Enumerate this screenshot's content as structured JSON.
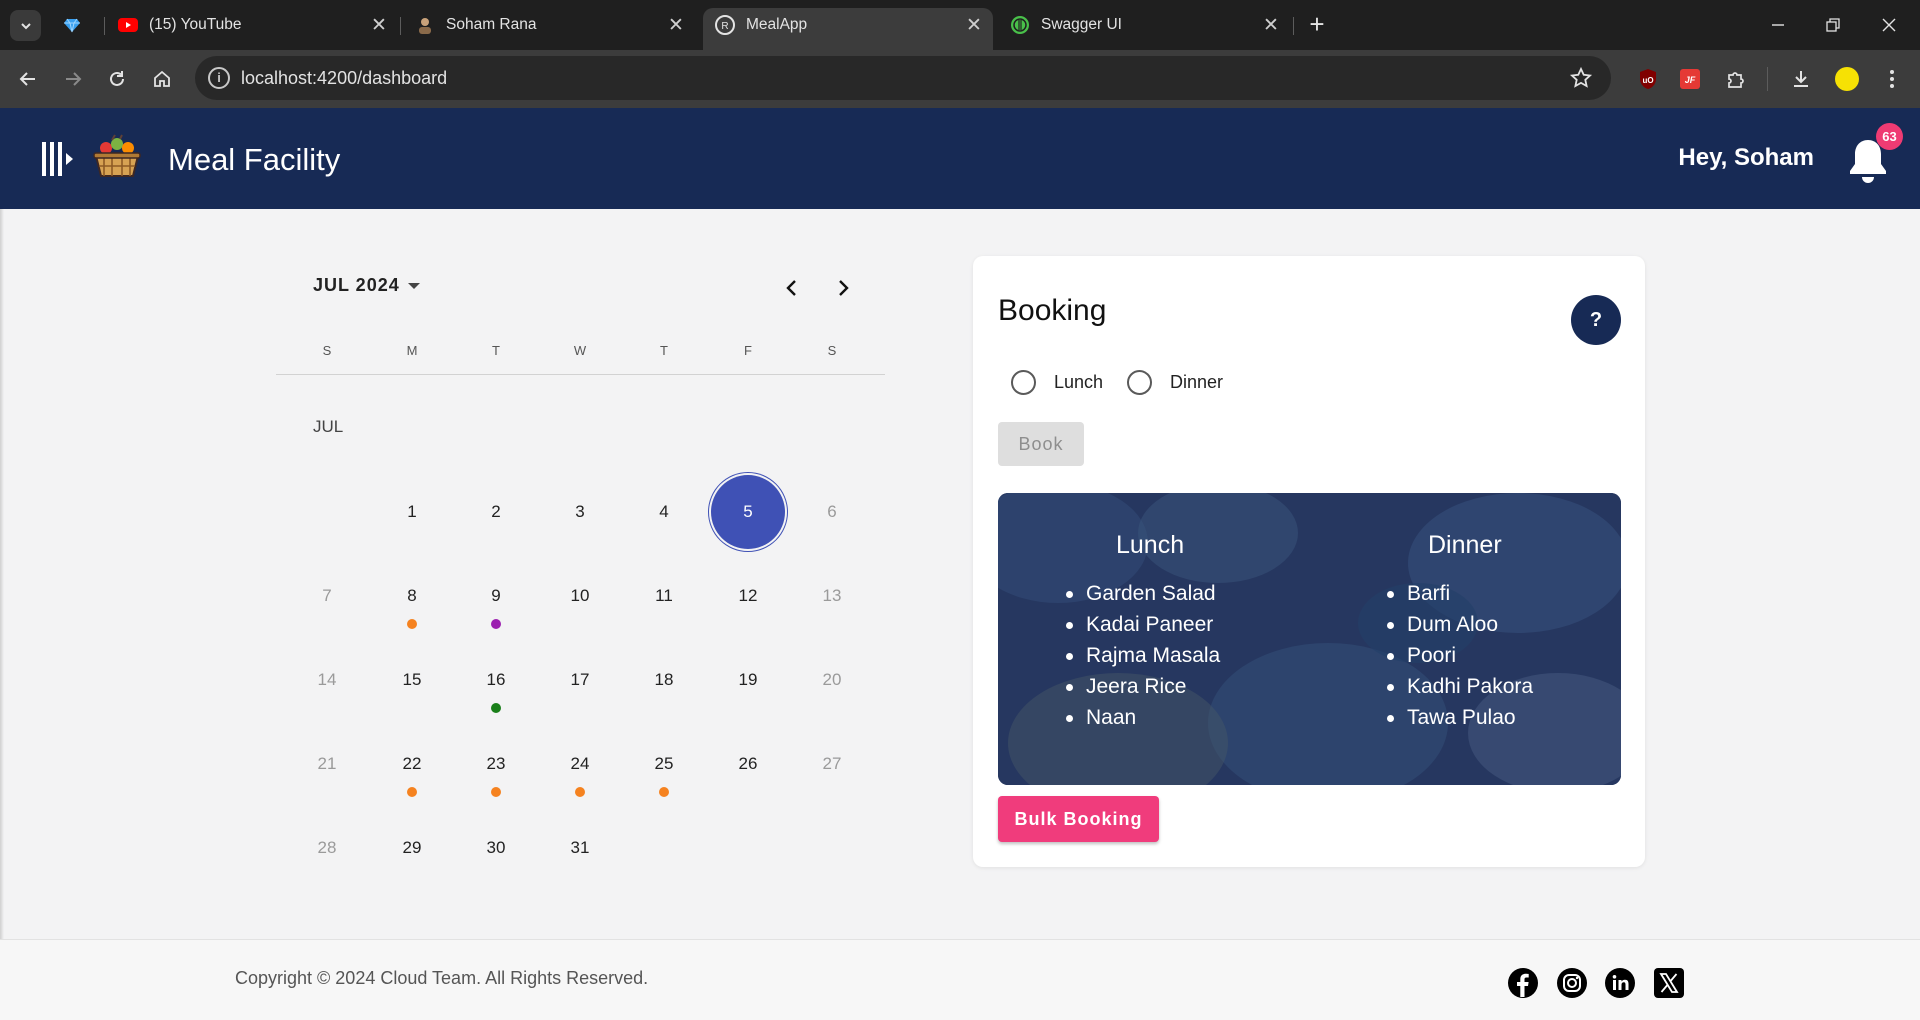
{
  "browser": {
    "tabs": [
      {
        "title": "(15) YouTube"
      },
      {
        "title": "Soham Rana"
      },
      {
        "title": "MealApp"
      },
      {
        "title": "Swagger UI"
      }
    ],
    "url": "localhost:4200/dashboard"
  },
  "header": {
    "title": "Meal Facility",
    "greeting": "Hey, Soham",
    "notification_count": "63"
  },
  "calendar": {
    "month_label": "JUL 2024",
    "weekdays": [
      "S",
      "M",
      "T",
      "W",
      "T",
      "F",
      "S"
    ],
    "section_label": "JUL",
    "selected_day": 5,
    "weeks": [
      [
        null,
        "1",
        "2",
        "3",
        "4",
        "5",
        "6"
      ],
      [
        "7",
        "8",
        "9",
        "10",
        "11",
        "12",
        "13"
      ],
      [
        "14",
        "15",
        "16",
        "17",
        "18",
        "19",
        "20"
      ],
      [
        "21",
        "22",
        "23",
        "24",
        "25",
        "26",
        "27"
      ],
      [
        "28",
        "29",
        "30",
        "31",
        null,
        null,
        null
      ]
    ],
    "markers": {
      "8": "#f5821f",
      "9": "#9c1fb0",
      "16": "#1a7f1a",
      "22": "#f5821f",
      "23": "#f5821f",
      "24": "#f5821f",
      "25": "#f5821f"
    }
  },
  "booking": {
    "title": "Booking",
    "help_label": "?",
    "options": [
      "Lunch",
      "Dinner"
    ],
    "book_label": "Book",
    "menu": {
      "lunch": {
        "title": "Lunch",
        "items": [
          "Garden Salad",
          "Kadai Paneer",
          "Rajma Masala",
          "Jeera Rice",
          "Naan"
        ]
      },
      "dinner": {
        "title": "Dinner",
        "items": [
          "Barfi",
          "Dum Aloo",
          "Poori",
          "Kadhi Pakora",
          "Tawa Pulao"
        ]
      }
    },
    "bulk_label": "Bulk Booking"
  },
  "footer": {
    "copyright": "Copyright © 2024 Cloud Team. All Rights Reserved."
  },
  "colors": {
    "header_bg": "#172a55",
    "selected_day": "#3f51b5",
    "bulk_button": "#f03c7c",
    "badge": "#ef3b73"
  }
}
